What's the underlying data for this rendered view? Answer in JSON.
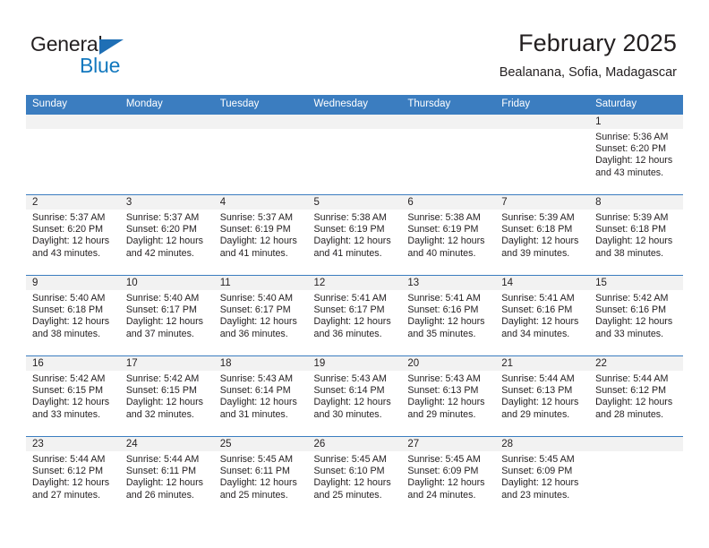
{
  "brand": {
    "line1": "General",
    "line2": "Blue",
    "flag_color": "#1f6fb5",
    "blue_color": "#1278be"
  },
  "header": {
    "month_title": "February 2025",
    "location": "Bealanana, Sofia, Madagascar"
  },
  "theme": {
    "header_bg": "#3b7dc0",
    "daynum_bg": "#f2f2f2",
    "text": "#231f20"
  },
  "weekdays": [
    "Sunday",
    "Monday",
    "Tuesday",
    "Wednesday",
    "Thursday",
    "Friday",
    "Saturday"
  ],
  "labels": {
    "sunrise_prefix": "Sunrise:",
    "sunset_prefix": "Sunset:",
    "daylight_prefix": "Daylight:"
  },
  "weeks": [
    [
      {
        "empty": true
      },
      {
        "empty": true
      },
      {
        "empty": true
      },
      {
        "empty": true
      },
      {
        "empty": true
      },
      {
        "empty": true
      },
      {
        "day": "1",
        "sunrise": "Sunrise: 5:36 AM",
        "sunset": "Sunset: 6:20 PM",
        "daylight": "Daylight: 12 hours and 43 minutes."
      }
    ],
    [
      {
        "day": "2",
        "sunrise": "Sunrise: 5:37 AM",
        "sunset": "Sunset: 6:20 PM",
        "daylight": "Daylight: 12 hours and 43 minutes."
      },
      {
        "day": "3",
        "sunrise": "Sunrise: 5:37 AM",
        "sunset": "Sunset: 6:20 PM",
        "daylight": "Daylight: 12 hours and 42 minutes."
      },
      {
        "day": "4",
        "sunrise": "Sunrise: 5:37 AM",
        "sunset": "Sunset: 6:19 PM",
        "daylight": "Daylight: 12 hours and 41 minutes."
      },
      {
        "day": "5",
        "sunrise": "Sunrise: 5:38 AM",
        "sunset": "Sunset: 6:19 PM",
        "daylight": "Daylight: 12 hours and 41 minutes."
      },
      {
        "day": "6",
        "sunrise": "Sunrise: 5:38 AM",
        "sunset": "Sunset: 6:19 PM",
        "daylight": "Daylight: 12 hours and 40 minutes."
      },
      {
        "day": "7",
        "sunrise": "Sunrise: 5:39 AM",
        "sunset": "Sunset: 6:18 PM",
        "daylight": "Daylight: 12 hours and 39 minutes."
      },
      {
        "day": "8",
        "sunrise": "Sunrise: 5:39 AM",
        "sunset": "Sunset: 6:18 PM",
        "daylight": "Daylight: 12 hours and 38 minutes."
      }
    ],
    [
      {
        "day": "9",
        "sunrise": "Sunrise: 5:40 AM",
        "sunset": "Sunset: 6:18 PM",
        "daylight": "Daylight: 12 hours and 38 minutes."
      },
      {
        "day": "10",
        "sunrise": "Sunrise: 5:40 AM",
        "sunset": "Sunset: 6:17 PM",
        "daylight": "Daylight: 12 hours and 37 minutes."
      },
      {
        "day": "11",
        "sunrise": "Sunrise: 5:40 AM",
        "sunset": "Sunset: 6:17 PM",
        "daylight": "Daylight: 12 hours and 36 minutes."
      },
      {
        "day": "12",
        "sunrise": "Sunrise: 5:41 AM",
        "sunset": "Sunset: 6:17 PM",
        "daylight": "Daylight: 12 hours and 36 minutes."
      },
      {
        "day": "13",
        "sunrise": "Sunrise: 5:41 AM",
        "sunset": "Sunset: 6:16 PM",
        "daylight": "Daylight: 12 hours and 35 minutes."
      },
      {
        "day": "14",
        "sunrise": "Sunrise: 5:41 AM",
        "sunset": "Sunset: 6:16 PM",
        "daylight": "Daylight: 12 hours and 34 minutes."
      },
      {
        "day": "15",
        "sunrise": "Sunrise: 5:42 AM",
        "sunset": "Sunset: 6:16 PM",
        "daylight": "Daylight: 12 hours and 33 minutes."
      }
    ],
    [
      {
        "day": "16",
        "sunrise": "Sunrise: 5:42 AM",
        "sunset": "Sunset: 6:15 PM",
        "daylight": "Daylight: 12 hours and 33 minutes."
      },
      {
        "day": "17",
        "sunrise": "Sunrise: 5:42 AM",
        "sunset": "Sunset: 6:15 PM",
        "daylight": "Daylight: 12 hours and 32 minutes."
      },
      {
        "day": "18",
        "sunrise": "Sunrise: 5:43 AM",
        "sunset": "Sunset: 6:14 PM",
        "daylight": "Daylight: 12 hours and 31 minutes."
      },
      {
        "day": "19",
        "sunrise": "Sunrise: 5:43 AM",
        "sunset": "Sunset: 6:14 PM",
        "daylight": "Daylight: 12 hours and 30 minutes."
      },
      {
        "day": "20",
        "sunrise": "Sunrise: 5:43 AM",
        "sunset": "Sunset: 6:13 PM",
        "daylight": "Daylight: 12 hours and 29 minutes."
      },
      {
        "day": "21",
        "sunrise": "Sunrise: 5:44 AM",
        "sunset": "Sunset: 6:13 PM",
        "daylight": "Daylight: 12 hours and 29 minutes."
      },
      {
        "day": "22",
        "sunrise": "Sunrise: 5:44 AM",
        "sunset": "Sunset: 6:12 PM",
        "daylight": "Daylight: 12 hours and 28 minutes."
      }
    ],
    [
      {
        "day": "23",
        "sunrise": "Sunrise: 5:44 AM",
        "sunset": "Sunset: 6:12 PM",
        "daylight": "Daylight: 12 hours and 27 minutes."
      },
      {
        "day": "24",
        "sunrise": "Sunrise: 5:44 AM",
        "sunset": "Sunset: 6:11 PM",
        "daylight": "Daylight: 12 hours and 26 minutes."
      },
      {
        "day": "25",
        "sunrise": "Sunrise: 5:45 AM",
        "sunset": "Sunset: 6:11 PM",
        "daylight": "Daylight: 12 hours and 25 minutes."
      },
      {
        "day": "26",
        "sunrise": "Sunrise: 5:45 AM",
        "sunset": "Sunset: 6:10 PM",
        "daylight": "Daylight: 12 hours and 25 minutes."
      },
      {
        "day": "27",
        "sunrise": "Sunrise: 5:45 AM",
        "sunset": "Sunset: 6:09 PM",
        "daylight": "Daylight: 12 hours and 24 minutes."
      },
      {
        "day": "28",
        "sunrise": "Sunrise: 5:45 AM",
        "sunset": "Sunset: 6:09 PM",
        "daylight": "Daylight: 12 hours and 23 minutes."
      },
      {
        "empty": true
      }
    ]
  ]
}
